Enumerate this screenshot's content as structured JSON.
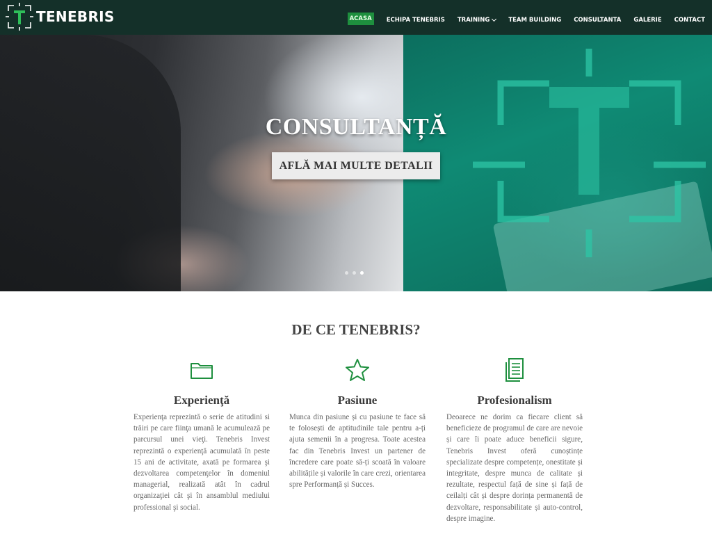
{
  "brand": {
    "name": "TENEBRIS",
    "accent": "#1e8f3e",
    "header_bg": "#143029"
  },
  "nav": {
    "items": [
      {
        "label": "ACASA"
      },
      {
        "label": "ECHIPA TENEBRIS"
      },
      {
        "label": "TRAINING"
      },
      {
        "label": "TEAM BUILDING"
      },
      {
        "label": "CONSULTANTA"
      },
      {
        "label": "GALERIE"
      },
      {
        "label": "CONTACT"
      }
    ],
    "active": "ACASA"
  },
  "hero": {
    "title": "CONSULTANȚĂ",
    "button_label": "AFLĂ MAI MULTE DETALII",
    "slides_count": 3,
    "active_slide": 3
  },
  "section": {
    "title": "DE CE TENEBRIS?",
    "columns": [
      {
        "icon": "folder-icon",
        "title": "Experienţă",
        "text": "Experienţa reprezintă o serie de atitudini si trăiri pe care fiinţa umană le acumulează pe parcursul unei vieţi. Tenebris Invest reprezintă o experienţă acumulată în peste 15 ani de activitate, axată pe formarea şi dezvoltarea competenţelor în domeniul managerial, realizată atât în cadrul organizaţiei cât şi în ansamblul mediului professional şi social."
      },
      {
        "icon": "star-icon",
        "title": "Pasiune",
        "text": "Munca din pasiune și cu pasiune te face să te folosești de aptitudinile tale pentru a-ți ajuta semenii în a progresa. Toate acestea fac din Tenebris Invest un partener de încredere care poate să-ți scoată în valoare abilitățile și valorile în care crezi, orientarea spre Performanță și Succes."
      },
      {
        "icon": "document-icon",
        "title": "Profesionalism",
        "text": "Deoarece ne dorim ca fiecare client să beneficieze de programul de care are nevoie și care îi poate aduce beneficii sigure, Tenebris Invest oferă cunoștințe specializate despre competențe, onestitate și integritate, despre munca de calitate și rezultate, respectul față de sine și față de ceilalți cât și despre dorința permanentă de dezvoltare, responsabilitate și auto-control, despre imagine."
      }
    ]
  }
}
